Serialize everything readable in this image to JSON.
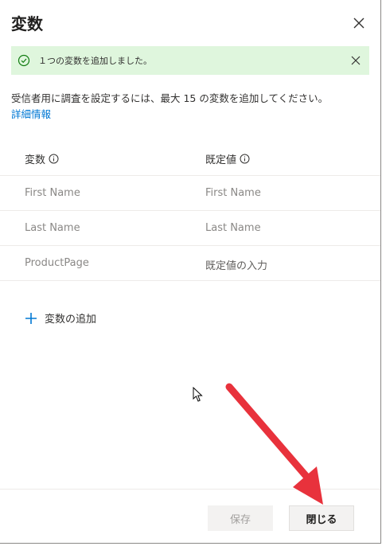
{
  "dialog": {
    "title": "変数",
    "banner_message": "１つの変数を追加しました。",
    "description": "受信者用に調査を設定するには、最大 15 の変数を追加してください。",
    "link": "詳細情報"
  },
  "table": {
    "headers": [
      "変数",
      "既定値"
    ],
    "rows": [
      {
        "variable": "First Name",
        "default": "First Name"
      },
      {
        "variable": "Last Name",
        "default": "Last Name"
      },
      {
        "variable": "ProductPage",
        "default": "既定値の入力"
      }
    ]
  },
  "add_label": "変数の追加",
  "buttons": {
    "save": "保存",
    "close": "閉じる"
  },
  "colors": {
    "accent": "#0078d4",
    "success_bg": "#dff6dd",
    "annotation": "#e8323c"
  }
}
